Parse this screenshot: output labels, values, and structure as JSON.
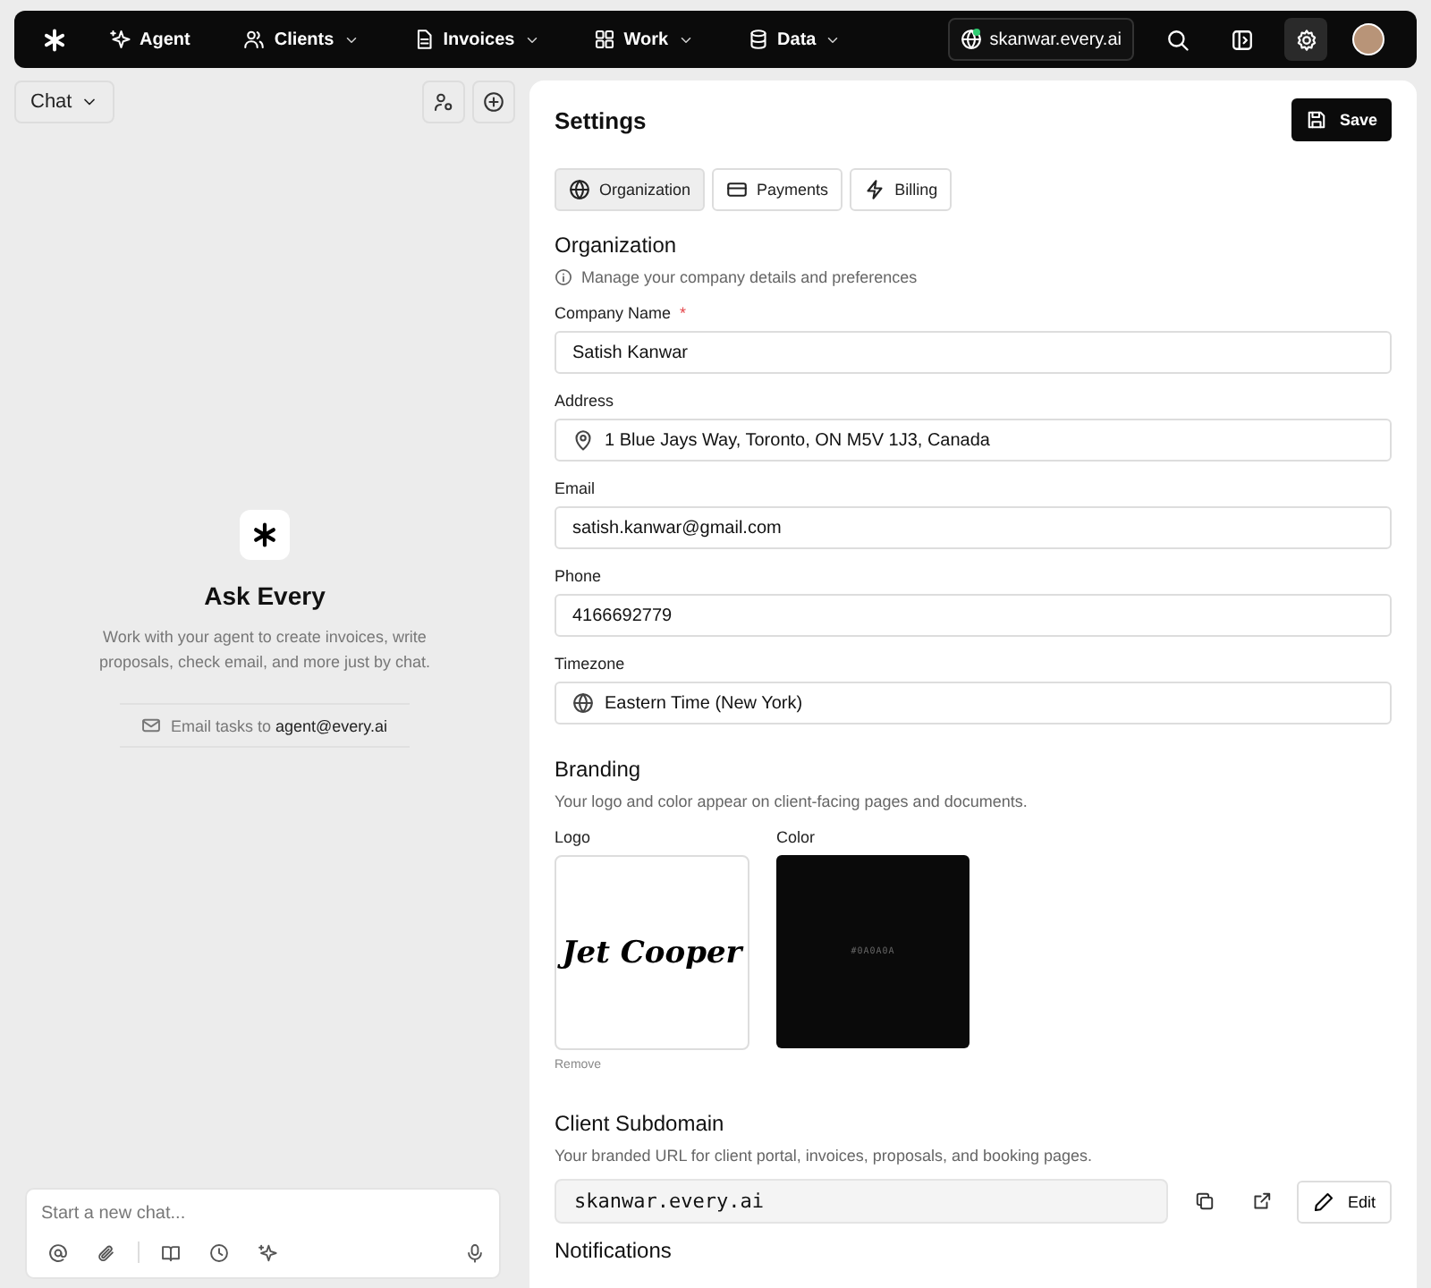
{
  "nav": {
    "items": [
      {
        "label": "Agent",
        "dropdown": false
      },
      {
        "label": "Clients",
        "dropdown": true
      },
      {
        "label": "Invoices",
        "dropdown": true
      },
      {
        "label": "Work",
        "dropdown": true
      },
      {
        "label": "Data",
        "dropdown": true
      }
    ],
    "domain": "skanwar.every.ai"
  },
  "chat": {
    "title": "Chat",
    "heading": "Ask Every",
    "description": "Work with your agent to create invoices, write proposals, check email, and more just by chat.",
    "email_prefix": "Email tasks to",
    "email": "agent@every.ai",
    "placeholder": "Start a new chat..."
  },
  "settings": {
    "title": "Settings",
    "save": "Save",
    "tabs": [
      {
        "label": "Organization",
        "selected": true
      },
      {
        "label": "Payments",
        "selected": false
      },
      {
        "label": "Billing",
        "selected": false
      }
    ],
    "section_title": "Organization",
    "section_note": "Manage your company details and preferences",
    "fields": [
      {
        "label": "Company Name",
        "required_mark": "*",
        "value": "Satish Kanwar"
      },
      {
        "label": "Address",
        "value": "1 Blue Jays Way, Toronto, ON M5V 1J3, Canada"
      },
      {
        "label": "Email",
        "value": "satish.kanwar@gmail.com"
      },
      {
        "label": "Phone",
        "value": "4166692779"
      },
      {
        "label": "Timezone",
        "value": "Eastern Time (New York)"
      }
    ],
    "branding": {
      "title": "Branding",
      "note": "Your logo and color appear on client-facing pages and documents.",
      "logo_label": "Logo",
      "logo_text": "Jet Cooper",
      "remove": "Remove",
      "color_label": "Color",
      "color": "#0a0a0a",
      "color_text": "#0A0A0A"
    },
    "subdomain": {
      "title": "Client Subdomain",
      "note": "Your branded URL for client portal, invoices, proposals, and booking pages.",
      "value": "skanwar.every.ai",
      "edit": "Edit"
    },
    "next_section": "Notifications"
  }
}
